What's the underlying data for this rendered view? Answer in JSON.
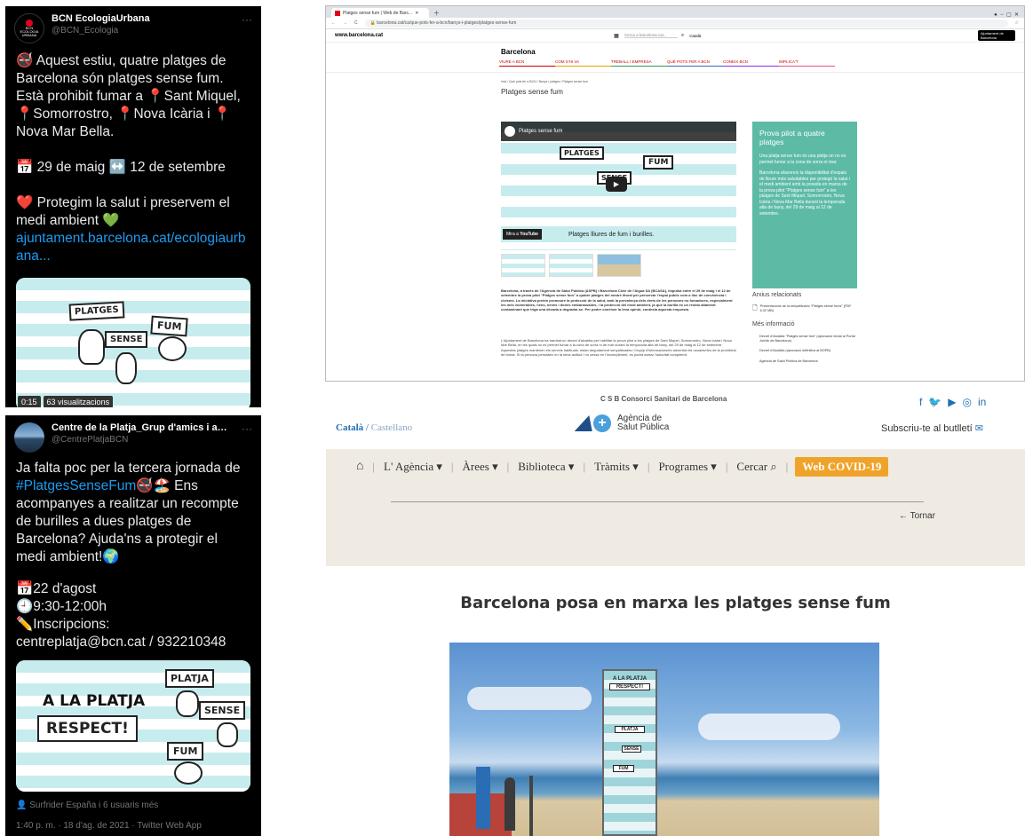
{
  "tweet1": {
    "name": "BCN EcologiaUrbana",
    "handle": "@BCN_Ecologia",
    "avatar_text": "BCN ECOLOGIA URBANA",
    "p1": "🚭 Aquest estiu, quatre platges de Barcelona són platges sense fum. Està prohibit fumar a 📍Sant Miquel, 📍Somorrostro, 📍Nova Icària i 📍Nova Mar Bella.",
    "p2": "📅 29 de maig ↔️ 12 de setembre",
    "p3": "❤️ Protegim la salut i preservem el medi ambient 💚",
    "link": "ajuntament.barcelona.cat/ecologiaurbana...",
    "card_words": [
      "PLATGES",
      "SENSE",
      "FUM"
    ],
    "duration": "0:15",
    "views": "63 visualitzacions"
  },
  "tweet2": {
    "name": "Centre de la Platja_Grup d'amics i amigues",
    "handle": "@CentrePlatjaBCN",
    "p1_pre": "Ja falta poc per la tercera jornada de ",
    "hashtag": "#PlatgesSenseFum",
    "p1_post": "🚭🏖️ Ens acompanyes a realitzar un recompte de burilles a dues platges de Barcelona? Ajuda'ns a protegir el medi ambient!🌍",
    "date": "📅22 d'agost",
    "time": "🕘9:30-12:00h",
    "insc": "✏️Inscripcions:",
    "contact": "centreplatja@bcn.cat / 932210348",
    "card_words": [
      "A LA PLATJA",
      "RESPECT!",
      "PLATJA",
      "SENSE",
      "FUM"
    ],
    "liked_by": "Surfrider España i 6 usuaris més",
    "timestamp": "1:40 p. m. · 18 d'ag. de 2021 · Twitter Web App"
  },
  "chrome": {
    "tab_title": "Platges sense fum | Web de Barc...",
    "url": "barcelona.cat/ca/que-pots-fer-a-bcn/banys-i-platges/platges-sense-fum",
    "site": "www.barcelona.cat",
    "search_placeholder": "Cerca a barcelona.cat...",
    "lang": "Català",
    "ajuntament": "Ajuntament de Barcelona",
    "section": "Barcelona",
    "nav": [
      "VIURE A BCN",
      "COM S'HI VA",
      "TREBALL I EMPRESA",
      "QUÈ POTS FER A BCN",
      "CONEIX BCN",
      "IMPLICA'T"
    ],
    "breadcrumb": "Inici / Què pots fer a BCN / Banys i platges / Platges sense fum",
    "page_title": "Platges sense fum",
    "video_title": "Platges sense fum",
    "video_caption": "Platges lliures de fum i burilles.",
    "watch_on": "Mira a",
    "youtube": "YouTube",
    "body1": "Barcelona, a través de l'Agència de Salut Pública (ASPB) i Barcelona Cicle de l'Aigua SA (BCASA), impulsa entre el 29 de maig i el 12 de setembre la prova pilot \"Platges sense fum\" a quatre platges del nostre litoral per preservar l'espai públic com a lloc de convivència i civisme. La iniciativa pretén promoure la protecció de la salut, amb la prevalença dels drets de les persones no fumadores, especialment les més vulnerables, nens, nenes i dones embarassades, i la protecció del medi ambient, ja que la burilla és un residu altament contaminant que triga una dècada a degradar-se. Per poder conèixer la teva opinió, contesta aquesta enquesta.",
    "body2": "L'Ajuntament de Barcelona ha tramitat un decret d'alcaldia per habilitar la prova pilot a les platges de Sant Miquel, Somorrostro, Nova Icària i Nova Mar Bella, en les quals no es permet fumar a la zona de sorra ni de mar durant la temporada alta de bany, del 29 de maig al 12 de setembre. Aquestes platges mantenen els serveis habituals, estan degudament senyalitzades i l'equip d'informadors/es advertirà els usuaris/ries de la prohibició de fumar. Si la persona persisteix en la seva actitud i no cessa en l'incompliment, es podrà avisar l'autoritat competent.",
    "box_title": "Prova pilot a quatre platges",
    "box_p1": "Una platja sense fum és una platja on no es permet fumar a la zona de sorra ni mar.",
    "box_p2": "Barcelona afavoreix la disponibilitat d'espais de lleure més saludables per protegir la salut i el medi ambient amb la posada en marxa de la prova pilot \"Platges sense fum\" a les platges de Sant Miquel, Somorrostro, Nova Icària i Nova Mar Bella durant la temporada alta de bany, del 29 de maig al 12 de setembre.",
    "files_title": "Arxius relacionats",
    "file1": "Presentacions de la senyalitzacio \"Platges sense fums\" (PDF 6.02 MB)",
    "more_title": "Més informació",
    "more": [
      "Decret d'Alcaldia \"Platges sense fum\" (aprovació inicial al Portal Jurídic de Barcelona)",
      "Decret d'Alcaldia (aprovació definitiva al BOPB)",
      "Agència de Salut Pública de Barcelona"
    ]
  },
  "aspb": {
    "csb": "C S B  Consorci Sanitari de Barcelona",
    "lang_active": "Català",
    "lang_other": "Castellano",
    "agency": "Agència de Salut Pública",
    "subscribe": "Subscriu-te al butlletí",
    "nav": [
      "L' Agència ▾",
      "Àrees ▾",
      "Biblioteca ▾",
      "Tràmits ▾",
      "Programes ▾",
      "Cercar"
    ],
    "covid": "Web COVID-19",
    "back": "← Tornar",
    "headline": "Barcelona posa en marxa les platges sense fum",
    "kiosk": [
      "A LA PLATJA",
      "RESPECT!",
      "PLATJA",
      "SENSE",
      "FUM"
    ]
  }
}
